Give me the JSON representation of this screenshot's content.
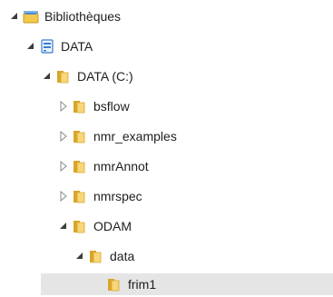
{
  "tree": {
    "nodes": [
      {
        "id": "bibliotheques",
        "label": "Bibliothèques",
        "icon": "library-icon",
        "state": "expanded",
        "selected": false
      },
      {
        "id": "data-drive",
        "label": "DATA",
        "icon": "drive-icon",
        "state": "expanded",
        "selected": false
      },
      {
        "id": "data-c",
        "label": "DATA (C:)",
        "icon": "folder-icon",
        "state": "expanded",
        "selected": false
      },
      {
        "id": "bsflow",
        "label": "bsflow",
        "icon": "folder-icon",
        "state": "collapsed",
        "selected": false
      },
      {
        "id": "nmr-examples",
        "label": "nmr_examples",
        "icon": "folder-icon",
        "state": "collapsed",
        "selected": false
      },
      {
        "id": "nmrannot",
        "label": "nmrAnnot",
        "icon": "folder-icon",
        "state": "collapsed",
        "selected": false
      },
      {
        "id": "nmrspec",
        "label": "nmrspec",
        "icon": "folder-icon",
        "state": "collapsed",
        "selected": false
      },
      {
        "id": "odam",
        "label": "ODAM",
        "icon": "folder-icon",
        "state": "expanded",
        "selected": false
      },
      {
        "id": "data-folder",
        "label": "data",
        "icon": "folder-icon",
        "state": "expanded",
        "selected": false
      },
      {
        "id": "frim1",
        "label": "frim1",
        "icon": "folder-icon",
        "state": "none",
        "selected": true
      }
    ]
  },
  "colors": {
    "selection": "#e5e5e5",
    "folder_light": "#f7d77a",
    "folder_dark": "#d9a62c",
    "drive_blue": "#3a7bd5",
    "expander": "#3c3c3c"
  }
}
